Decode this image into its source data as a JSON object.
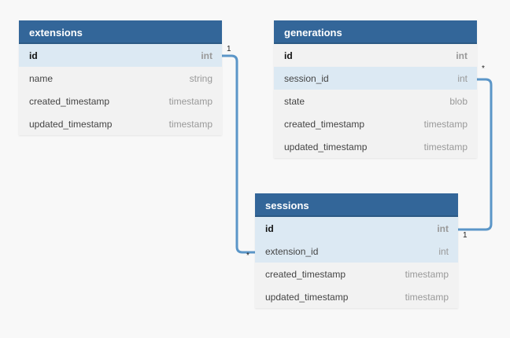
{
  "colors": {
    "header_bg": "#336699",
    "connector": "#5b96c8",
    "fk_row_highlight": "#dce9f3",
    "row_bg": "#f2f2f2",
    "canvas_bg": "#f8f8f8"
  },
  "entities": [
    {
      "id": "extensions",
      "title": "extensions",
      "columns": [
        {
          "name": "id",
          "type": "int",
          "primary_key": true
        },
        {
          "name": "name",
          "type": "string"
        },
        {
          "name": "created_timestamp",
          "type": "timestamp"
        },
        {
          "name": "updated_timestamp",
          "type": "timestamp"
        }
      ]
    },
    {
      "id": "generations",
      "title": "generations",
      "columns": [
        {
          "name": "id",
          "type": "int",
          "primary_key": true
        },
        {
          "name": "session_id",
          "type": "int",
          "foreign_key": true
        },
        {
          "name": "state",
          "type": "blob"
        },
        {
          "name": "created_timestamp",
          "type": "timestamp"
        },
        {
          "name": "updated_timestamp",
          "type": "timestamp"
        }
      ]
    },
    {
      "id": "sessions",
      "title": "sessions",
      "columns": [
        {
          "name": "id",
          "type": "int",
          "primary_key": true
        },
        {
          "name": "extension_id",
          "type": "int",
          "foreign_key": true
        },
        {
          "name": "created_timestamp",
          "type": "timestamp"
        },
        {
          "name": "updated_timestamp",
          "type": "timestamp"
        }
      ]
    }
  ],
  "relationships": [
    {
      "from": "extensions.id",
      "to": "sessions.extension_id",
      "from_cardinality": "1",
      "to_cardinality": "*"
    },
    {
      "from": "sessions.id",
      "to": "generations.session_id",
      "from_cardinality": "1",
      "to_cardinality": "*"
    }
  ]
}
